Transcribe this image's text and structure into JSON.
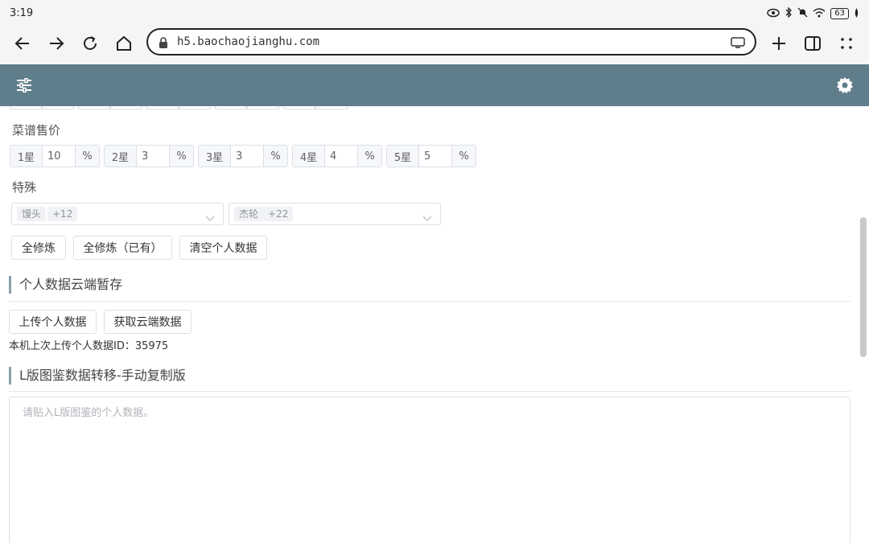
{
  "status": {
    "time": "3:19",
    "battery": "63"
  },
  "browser": {
    "url": "h5.baochaojianghu.com"
  },
  "sections": {
    "price_label": "菜谱售价",
    "special_label": "特殊"
  },
  "stars": [
    {
      "label": "1星",
      "value": "10",
      "suffix": "%"
    },
    {
      "label": "2星",
      "value": "3",
      "suffix": "%"
    },
    {
      "label": "3星",
      "value": "3",
      "suffix": "%"
    },
    {
      "label": "4星",
      "value": "4",
      "suffix": "%"
    },
    {
      "label": "5星",
      "value": "5",
      "suffix": "%"
    }
  ],
  "selects": [
    {
      "tag": "馒头",
      "more": "+12"
    },
    {
      "tag": "杰轮",
      "more": "+22"
    }
  ],
  "buttons": {
    "full_train": "全修炼",
    "full_train_owned": "全修炼（已有）",
    "clear_data": "清空个人数据",
    "upload": "上传个人数据",
    "fetch": "获取云端数据"
  },
  "cloud": {
    "heading": "个人数据云端暂存",
    "note": "本机上次上传个人数据ID：35975"
  },
  "transfer": {
    "heading": "L版图鉴数据转移-手动复制版",
    "placeholder": "请贴入L版图鉴的个人数据。"
  },
  "colors": {
    "header": "#607d8b",
    "accent_bar": "#8aa1ad"
  }
}
